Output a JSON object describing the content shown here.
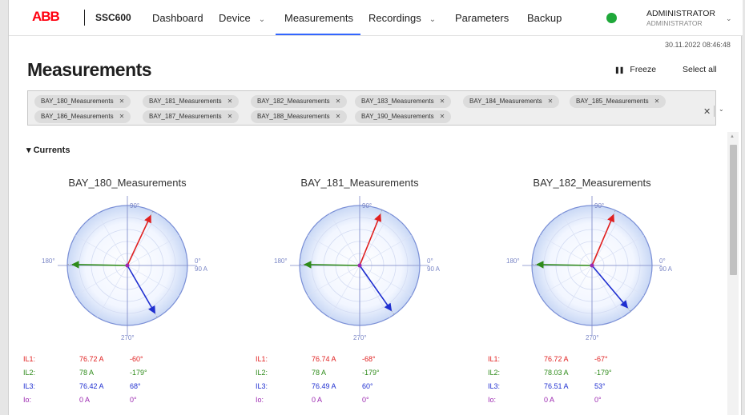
{
  "nav": {
    "logo": "ABB",
    "product": "SSC600",
    "items": [
      {
        "label": "Dashboard",
        "chevron": false
      },
      {
        "label": "Device",
        "chevron": true
      },
      {
        "label": "Measurements",
        "chevron": false
      },
      {
        "label": "Recordings",
        "chevron": true
      },
      {
        "label": "Parameters",
        "chevron": false
      },
      {
        "label": "Backup",
        "chevron": false
      }
    ],
    "active": "Measurements",
    "status_color": "#1fa83a",
    "user_name": "ADMINISTRATOR",
    "user_role": "ADMINISTRATOR"
  },
  "datetime": "30.11.2022  08:46:48",
  "page": {
    "title": "Measurements",
    "freeze_label": "Freeze",
    "select_all_label": "Select all"
  },
  "chips": [
    "BAY_180_Measurements",
    "BAY_181_Measurements",
    "BAY_182_Measurements",
    "BAY_183_Measurements",
    "BAY_184_Measurements",
    "BAY_185_Measurements",
    "BAY_186_Measurements",
    "BAY_187_Measurements",
    "BAY_188_Measurements",
    "BAY_190_Measurements"
  ],
  "section": {
    "title": "Currents"
  },
  "axis_labels": {
    "top": "90°",
    "left": "180°",
    "right": "0°",
    "right_value": "90 A",
    "bottom": "270°"
  },
  "colors": {
    "IL1": "#e02020",
    "IL2": "#2e8b1a",
    "IL3": "#1f2fd0",
    "Io": "#9b27b0",
    "accent": "#3366ff"
  },
  "gauges": [
    {
      "name": "BAY_180_Measurements",
      "phasors": [
        {
          "label": "IL1:",
          "magnitude": "76.72 A",
          "angle": "-60°",
          "arrow_deg": 65
        },
        {
          "label": "IL2:",
          "magnitude": "78 A",
          "angle": "-179°",
          "arrow_deg": 179
        },
        {
          "label": "IL3:",
          "magnitude": "76.42 A",
          "angle": "68°",
          "arrow_deg": -60
        },
        {
          "label": "Io:",
          "magnitude": "0 A",
          "angle": "0°",
          "arrow_deg": null
        }
      ]
    },
    {
      "name": "BAY_181_Measurements",
      "phasors": [
        {
          "label": "IL1:",
          "magnitude": "76.74 A",
          "angle": "-68°",
          "arrow_deg": 68
        },
        {
          "label": "IL2:",
          "magnitude": "78 A",
          "angle": "-179°",
          "arrow_deg": 179
        },
        {
          "label": "IL3:",
          "magnitude": "76.49 A",
          "angle": "60°",
          "arrow_deg": -55
        },
        {
          "label": "Io:",
          "magnitude": "0 A",
          "angle": "0°",
          "arrow_deg": null
        }
      ]
    },
    {
      "name": "BAY_182_Measurements",
      "phasors": [
        {
          "label": "IL1:",
          "magnitude": "76.72 A",
          "angle": "-67°",
          "arrow_deg": 67
        },
        {
          "label": "IL2:",
          "magnitude": "78.03 A",
          "angle": "-179°",
          "arrow_deg": 179
        },
        {
          "label": "IL3:",
          "magnitude": "76.51 A",
          "angle": "53°",
          "arrow_deg": -50
        },
        {
          "label": "Io:",
          "magnitude": "0 A",
          "angle": "0°",
          "arrow_deg": null
        }
      ]
    }
  ]
}
